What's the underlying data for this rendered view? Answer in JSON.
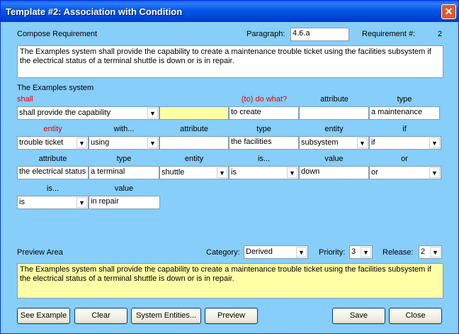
{
  "window": {
    "title": "Template #2: Association with Condition",
    "close_glyph": "✕"
  },
  "compose": {
    "label": "Compose Requirement",
    "paragraph_label": "Paragraph:",
    "paragraph_value": "4.6.a",
    "requirement_label": "Requirement #:",
    "requirement_value": "2",
    "text": "The Examples system shall provide the capability to create a maintenance trouble ticket using the facilities subsystem if the electrical status of a terminal shuttle is down or is in repair."
  },
  "system_label": "The Examples system",
  "row1": {
    "headers": {
      "shall": "shall",
      "do_what": "(to) do what?",
      "attribute": "attribute",
      "type": "type"
    },
    "shall_value": "shall provide the capability",
    "do_what_value": "to create",
    "attribute_value": "",
    "type_value": "a maintenance"
  },
  "row2": {
    "headers": {
      "entity": "entity",
      "with": "with...",
      "attribute": "attribute",
      "type": "type",
      "entity2": "entity",
      "if": "if"
    },
    "entity_value": "trouble ticket",
    "with_value": "using",
    "attribute_value": "",
    "type_value": "the facilities",
    "entity2_value": "subsystem",
    "if_value": "if"
  },
  "row3": {
    "headers": {
      "attribute": "attribute",
      "type": "type",
      "entity": "entity",
      "is": "is...",
      "value": "value",
      "or": "or"
    },
    "attribute_value": "the electrical status",
    "type_value": "a terminal",
    "entity_value": "shuttle",
    "is_value": "is",
    "value_value": "down",
    "or_value": "or"
  },
  "row4": {
    "headers": {
      "is": "is...",
      "value": "value"
    },
    "is_value": "is",
    "value_value": "in repair"
  },
  "preview": {
    "label": "Preview Area",
    "category_label": "Category:",
    "category_value": "Derived",
    "priority_label": "Priority:",
    "priority_value": "3",
    "release_label": "Release:",
    "release_value": "2",
    "text": "The Examples system shall provide the capability to create a maintenance trouble ticket using the facilities subsystem if the electrical status of a terminal shuttle is down or is in repair."
  },
  "buttons": {
    "see_example": "See Example",
    "clear": "Clear",
    "system_entities": "System Entities...",
    "preview": "Preview",
    "save": "Save",
    "close": "Close"
  },
  "icons": {
    "dropdown_arrow": "chevron-down-icon"
  },
  "colors": {
    "background": "#87cefa",
    "highlight": "#ffffa6",
    "required_label": "#e00000"
  }
}
